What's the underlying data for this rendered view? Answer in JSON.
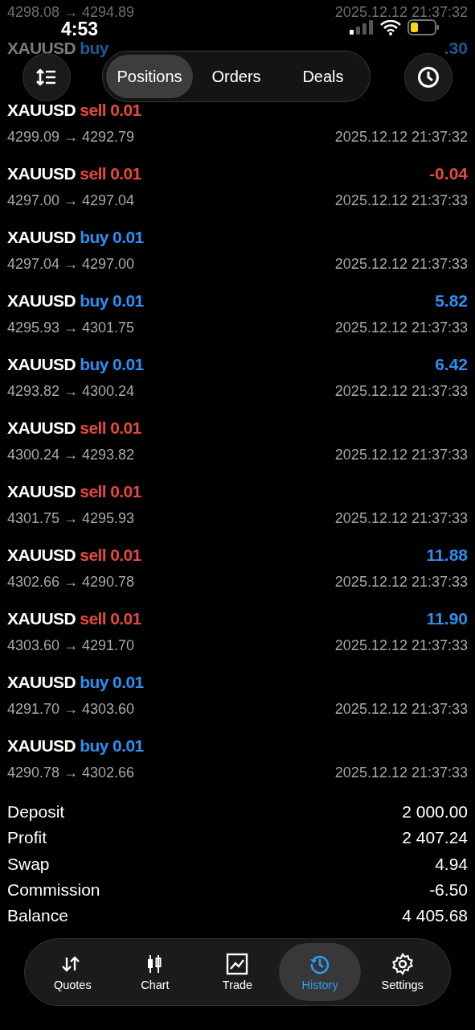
{
  "status_bar": {
    "time": "4:53"
  },
  "segments": [
    {
      "label": "Positions",
      "selected": true
    },
    {
      "label": "Orders",
      "selected": false
    },
    {
      "label": "Deals",
      "selected": false
    }
  ],
  "deals": [
    {
      "faded": true,
      "prices": "4298.08 → 4294.89",
      "time": "2025.12.12 21:37:32"
    },
    {
      "faded": true,
      "kind": "buy",
      "symbol": "XAUUSD",
      "side": "buy",
      "profit": ".30",
      "color": "#1d5a99"
    },
    {
      "faded": false,
      "kind": "sell",
      "symbol": "XAUUSD",
      "side": "sell",
      "volume": "0.01",
      "prices": "4299.09 → 4292.79",
      "time": "2025.12.12 21:37:32"
    },
    {
      "faded": false,
      "kind": "sell",
      "symbol": "XAUUSD",
      "side": "sell",
      "volume": "0.01",
      "profit": "-0.04",
      "color": "#e5493e",
      "prices": "4297.00 → 4297.04",
      "time": "2025.12.12 21:37:33"
    },
    {
      "faded": false,
      "kind": "buy",
      "symbol": "XAUUSD",
      "side": "buy",
      "volume": "0.01",
      "prices": "4297.04 → 4297.00",
      "time": "2025.12.12 21:37:33"
    },
    {
      "faded": false,
      "kind": "buy",
      "symbol": "XAUUSD",
      "side": "buy",
      "volume": "0.01",
      "profit": "5.82",
      "color": "#2d8ff0",
      "prices": "4295.93 → 4301.75",
      "time": "2025.12.12 21:37:33"
    },
    {
      "faded": false,
      "kind": "buy",
      "symbol": "XAUUSD",
      "side": "buy",
      "volume": "0.01",
      "profit": "6.42",
      "color": "#2d8ff0",
      "prices": "4293.82 → 4300.24",
      "time": "2025.12.12 21:37:33"
    },
    {
      "faded": false,
      "kind": "sell",
      "symbol": "XAUUSD",
      "side": "sell",
      "volume": "0.01",
      "prices": "4300.24 → 4293.82",
      "time": "2025.12.12 21:37:33"
    },
    {
      "faded": false,
      "kind": "sell",
      "symbol": "XAUUSD",
      "side": "sell",
      "volume": "0.01",
      "prices": "4301.75 → 4295.93",
      "time": "2025.12.12 21:37:33"
    },
    {
      "faded": false,
      "kind": "sell",
      "symbol": "XAUUSD",
      "side": "sell",
      "volume": "0.01",
      "profit": "11.88",
      "color": "#2d8ff0",
      "prices": "4302.66 → 4290.78",
      "time": "2025.12.12 21:37:33"
    },
    {
      "faded": false,
      "kind": "sell",
      "symbol": "XAUUSD",
      "side": "sell",
      "volume": "0.01",
      "profit": "11.90",
      "color": "#2d8ff0",
      "prices": "4303.60 → 4291.70",
      "time": "2025.12.12 21:37:33"
    },
    {
      "faded": false,
      "kind": "buy",
      "symbol": "XAUUSD",
      "side": "buy",
      "volume": "0.01",
      "prices": "4291.70 → 4303.60",
      "time": "2025.12.12 21:37:33"
    },
    {
      "faded": false,
      "kind": "buy",
      "symbol": "XAUUSD",
      "side": "buy",
      "volume": "0.01",
      "prices": "4290.78 → 4302.66",
      "time": "2025.12.12 21:37:33"
    }
  ],
  "summary": [
    {
      "label": "Deposit",
      "value": "2 000.00"
    },
    {
      "label": "Profit",
      "value": "2 407.24"
    },
    {
      "label": "Swap",
      "value": "4.94"
    },
    {
      "label": "Commission",
      "value": "-6.50"
    },
    {
      "label": "Balance",
      "value": "4 405.68"
    }
  ],
  "tab_bar": [
    {
      "kind": "quotes",
      "label": "Quotes",
      "selected": false
    },
    {
      "kind": "chart",
      "label": "Chart",
      "selected": false
    },
    {
      "kind": "trade",
      "label": "Trade",
      "selected": false
    },
    {
      "kind": "history",
      "label": "History",
      "selected": true
    },
    {
      "kind": "settings",
      "label": "Settings",
      "selected": false
    }
  ]
}
